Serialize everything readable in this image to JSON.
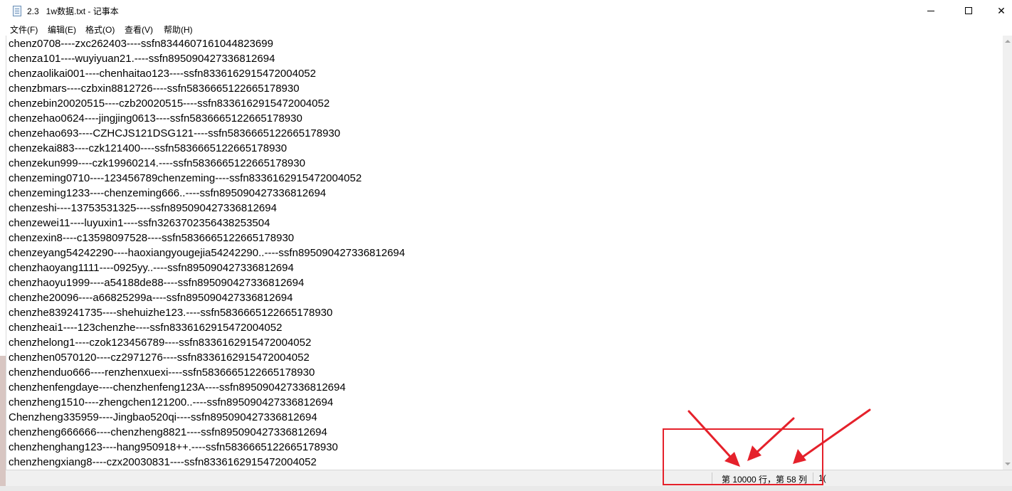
{
  "window": {
    "title": "2.3   1w数据.txt - 记事本",
    "minimize_symbol": "",
    "close_symbol": "✕"
  },
  "menu": [
    "文件(F)",
    "编辑(E)",
    "格式(O)",
    "查看(V)",
    "帮助(H)"
  ],
  "lines": [
    "chenz0708----zxc262403----ssfn8344607161044823699",
    "chenza101----wuyiyuan21.----ssfn895090427336812694",
    "chenzaolikai001----chenhaitao123----ssfn8336162915472004052",
    "chenzbmars----czbxin8812726----ssfn5836665122665178930",
    "chenzebin20020515----czb20020515----ssfn8336162915472004052",
    "chenzehao0624----jingjing0613----ssfn5836665122665178930",
    "chenzehao693----CZHCJS121DSG121----ssfn5836665122665178930",
    "chenzekai883----czk121400----ssfn5836665122665178930",
    "chenzekun999----czk19960214.----ssfn5836665122665178930",
    "chenzeming0710----123456789chenzeming----ssfn8336162915472004052",
    "chenzeming1233----chenzeming666..----ssfn895090427336812694",
    "chenzeshi----13753531325----ssfn895090427336812694",
    "chenzewei11----luyuxin1----ssfn3263702356438253504",
    "chenzexin8----c13598097528----ssfn5836665122665178930",
    "chenzeyang54242290----haoxiangyougejia54242290..----ssfn895090427336812694",
    "chenzhaoyang1111----0925yy..----ssfn895090427336812694",
    "chenzhaoyu1999----a54188de88----ssfn895090427336812694",
    "chenzhe20096----a66825299a----ssfn895090427336812694",
    "chenzhe839241735----shehuizhe123.----ssfn5836665122665178930",
    "chenzheai1----123chenzhe----ssfn8336162915472004052",
    "chenzhelong1----czok123456789----ssfn8336162915472004052",
    "chenzhen0570120----cz2971276----ssfn8336162915472004052",
    "chenzhenduo666----renzhenxuexi----ssfn5836665122665178930",
    "chenzhenfengdaye----chenzhenfeng123A----ssfn895090427336812694",
    "chenzheng1510----zhengchen121200..----ssfn895090427336812694",
    "Chenzheng335959----Jingbao520qi----ssfn895090427336812694",
    "chenzheng666666----chenzheng8821----ssfn895090427336812694",
    "chenzhenghang123----hang950918++.----ssfn5836665122665178930",
    "chenzhengxiang8----czx20030831----ssfn8336162915472004052"
  ],
  "status": {
    "position": "第 10000 行，第 58 列",
    "next": "1("
  },
  "colors": {
    "annotation": "#e5212b",
    "statusbar": "#f0f0f0"
  }
}
